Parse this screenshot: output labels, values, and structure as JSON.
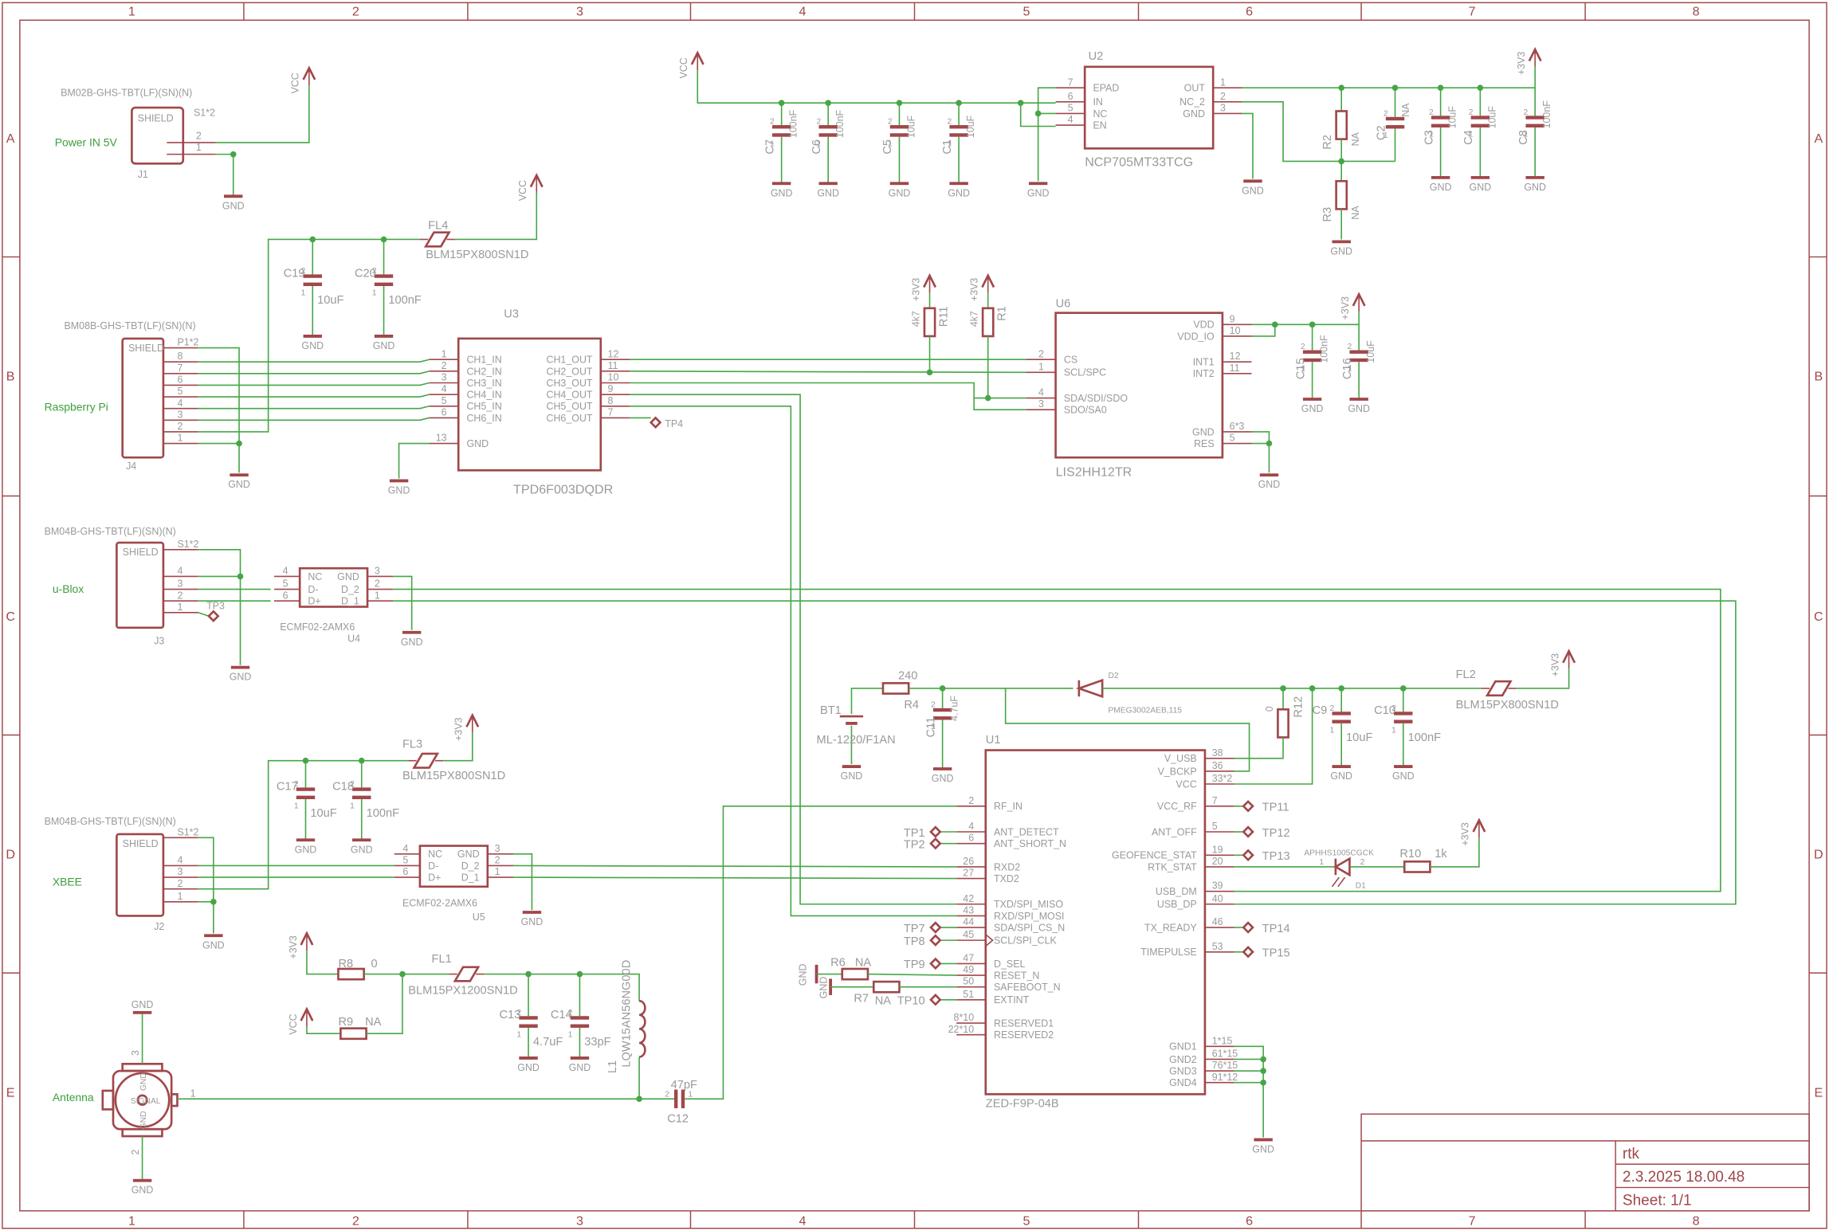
{
  "frame": {
    "columns": [
      "1",
      "2",
      "3",
      "4",
      "5",
      "6",
      "7",
      "8"
    ],
    "rows": [
      "A",
      "B",
      "C",
      "D",
      "E"
    ]
  },
  "title_block": {
    "name": "rtk",
    "date": "2.3.2025 18.00.48",
    "sheet": "Sheet: 1/1"
  },
  "nets": {
    "gnd": "GND",
    "vcc": "VCC",
    "v33": "+3V3",
    "power_in": "Power IN 5V",
    "raspberry_pi": "Raspberry Pi",
    "ublox": "u-Blox",
    "xbee": "XBEE",
    "antenna": "Antenna"
  },
  "cap_pins": [
    "1",
    "2"
  ],
  "colors": {
    "part": "#a0474a",
    "wire": "#46a646",
    "text": "#9a9a9a",
    "net_label": "#3c9e3c"
  },
  "parts": {
    "J1": {
      "ref": "J1",
      "value": "BM02B-GHS-TBT(LF)(SN)(N)",
      "shield": "SHIELD",
      "shield_pin": "S1*2",
      "pins": [
        "2",
        "1"
      ]
    },
    "J4": {
      "ref": "J4",
      "value": "BM08B-GHS-TBT(LF)(SN)(N)",
      "shield": "SHIELD",
      "shield_pin": "P1*2",
      "pins": [
        "8",
        "7",
        "6",
        "5",
        "4",
        "3",
        "2",
        "1"
      ]
    },
    "J3": {
      "ref": "J3",
      "value": "BM04B-GHS-TBT(LF)(SN)(N)",
      "shield": "SHIELD",
      "shield_pin": "S1*2",
      "pins": [
        "4",
        "3",
        "2",
        "1"
      ]
    },
    "J2": {
      "ref": "J2",
      "value": "BM04B-GHS-TBT(LF)(SN)(N)",
      "shield": "SHIELD",
      "shield_pin": "S1*2",
      "pins": [
        "4",
        "3",
        "2",
        "1"
      ]
    },
    "U2": {
      "ref": "U2",
      "value": "NCP705MT33TCG",
      "left": [
        {
          "name": "EPAD",
          "pin": "7"
        },
        {
          "name": "IN",
          "pin": "6"
        },
        {
          "name": "NC",
          "pin": "5"
        },
        {
          "name": "EN",
          "pin": "4"
        }
      ],
      "right": [
        {
          "name": "OUT",
          "pin": "1"
        },
        {
          "name": "NC_2",
          "pin": "2"
        },
        {
          "name": "GND",
          "pin": "3"
        }
      ]
    },
    "U3": {
      "ref": "U3",
      "value": "TPD6F003DQDR",
      "left": [
        {
          "name": "CH1_IN",
          "pin": "1"
        },
        {
          "name": "CH2_IN",
          "pin": "2"
        },
        {
          "name": "CH3_IN",
          "pin": "3"
        },
        {
          "name": "CH4_IN",
          "pin": "4"
        },
        {
          "name": "CH5_IN",
          "pin": "5"
        },
        {
          "name": "CH6_IN",
          "pin": "6"
        },
        {
          "name": "GND",
          "pin": "13"
        }
      ],
      "right": [
        {
          "name": "CH1_OUT",
          "pin": "12"
        },
        {
          "name": "CH2_OUT",
          "pin": "11"
        },
        {
          "name": "CH3_OUT",
          "pin": "10"
        },
        {
          "name": "CH4_OUT",
          "pin": "9"
        },
        {
          "name": "CH5_OUT",
          "pin": "8"
        },
        {
          "name": "CH6_OUT",
          "pin": "7"
        }
      ]
    },
    "U6": {
      "ref": "U6",
      "value": "LIS2HH12TR",
      "left": [
        {
          "name": "CS",
          "pin": "2"
        },
        {
          "name": "SCL/SPC",
          "pin": "1"
        },
        {
          "name": "SDA/SDI/SDO",
          "pin": "4"
        },
        {
          "name": "SDO/SA0",
          "pin": "3"
        }
      ],
      "right": [
        {
          "name": "VDD",
          "pin": "9"
        },
        {
          "name": "VDD_IO",
          "pin": "10"
        },
        {
          "name": "INT1",
          "pin": "12"
        },
        {
          "name": "INT2",
          "pin": "11"
        },
        {
          "name": "GND",
          "pin": "6*3"
        },
        {
          "name": "RES",
          "pin": "5"
        }
      ]
    },
    "U4": {
      "ref": "U4",
      "value": "ECMF02-2AMX6",
      "left": [
        {
          "name": "NC",
          "pin": "4"
        },
        {
          "name": "D-",
          "pin": "5"
        },
        {
          "name": "D+",
          "pin": "6"
        }
      ],
      "right": [
        {
          "name": "GND",
          "pin": "3"
        },
        {
          "name": "D_2",
          "pin": "2"
        },
        {
          "name": "D_1",
          "pin": "1"
        }
      ]
    },
    "U5": {
      "ref": "U5",
      "value": "ECMF02-2AMX6",
      "left": [
        {
          "name": "NC",
          "pin": "4"
        },
        {
          "name": "D-",
          "pin": "5"
        },
        {
          "name": "D+",
          "pin": "6"
        }
      ],
      "right": [
        {
          "name": "GND",
          "pin": "3"
        },
        {
          "name": "D_2",
          "pin": "2"
        },
        {
          "name": "D_1",
          "pin": "1"
        }
      ]
    },
    "U1": {
      "ref": "U1",
      "value": "ZED-F9P-04B",
      "left": [
        {
          "name": "RF_IN",
          "pin": "2"
        },
        {
          "name": "ANT_DETECT",
          "pin": "4"
        },
        {
          "name": "ANT_SHORT_N",
          "pin": "6"
        },
        {
          "name": "RXD2",
          "pin": "26"
        },
        {
          "name": "TXD2",
          "pin": "27"
        },
        {
          "name": "TXD/SPI_MISO",
          "pin": "42"
        },
        {
          "name": "RXD/SPI_MOSI",
          "pin": "43"
        },
        {
          "name": "SDA/SPI_CS_N",
          "pin": "44"
        },
        {
          "name": "SCL/SPI_CLK",
          "pin": "45"
        },
        {
          "name": "D_SEL",
          "pin": "47"
        },
        {
          "name": "RESET_N",
          "pin": "49"
        },
        {
          "name": "SAFEBOOT_N",
          "pin": "50"
        },
        {
          "name": "EXTINT",
          "pin": "51"
        },
        {
          "name": "RESERVED1",
          "pin": "8*10"
        },
        {
          "name": "RESERVED2",
          "pin": "22*10"
        }
      ],
      "right": [
        {
          "name": "V_USB",
          "pin": "38"
        },
        {
          "name": "V_BCKP",
          "pin": "36"
        },
        {
          "name": "VCC",
          "pin": "33*2"
        },
        {
          "name": "VCC_RF",
          "pin": "7"
        },
        {
          "name": "ANT_OFF",
          "pin": "5"
        },
        {
          "name": "GEOFENCE_STAT",
          "pin": "19"
        },
        {
          "name": "RTK_STAT",
          "pin": "20"
        },
        {
          "name": "USB_DM",
          "pin": "39"
        },
        {
          "name": "USB_DP",
          "pin": "40"
        },
        {
          "name": "TX_READY",
          "pin": "46"
        },
        {
          "name": "TIMEPULSE",
          "pin": "53"
        },
        {
          "name": "GND1",
          "pin": "1*15"
        },
        {
          "name": "GND2",
          "pin": "61*15"
        },
        {
          "name": "GND3",
          "pin": "76*15"
        },
        {
          "name": "GND4",
          "pin": "91*12"
        }
      ]
    },
    "caps": {
      "C7": {
        "ref": "C7",
        "value": "100nF"
      },
      "C6": {
        "ref": "C6",
        "value": "100nF"
      },
      "C5": {
        "ref": "C5",
        "value": "10uF"
      },
      "C1": {
        "ref": "C1",
        "value": "10uF"
      },
      "C2": {
        "ref": "C2",
        "value": "NA"
      },
      "C3": {
        "ref": "C3",
        "value": "10uF"
      },
      "C4": {
        "ref": "C4",
        "value": "10uF"
      },
      "C8": {
        "ref": "C8",
        "value": "100nF"
      },
      "C19": {
        "ref": "C19",
        "value": "10uF"
      },
      "C20": {
        "ref": "C20",
        "value": "100nF"
      },
      "C15": {
        "ref": "C15",
        "value": "100nF"
      },
      "C16": {
        "ref": "C16",
        "value": "10uF"
      },
      "C11": {
        "ref": "C11",
        "value": "4.7uF"
      },
      "C9": {
        "ref": "C9",
        "value": "10uF"
      },
      "C10": {
        "ref": "C10",
        "value": "100nF"
      },
      "C17": {
        "ref": "C17",
        "value": "10uF"
      },
      "C18": {
        "ref": "C18",
        "value": "100nF"
      },
      "C13": {
        "ref": "C13",
        "value": "4.7uF"
      },
      "C14": {
        "ref": "C14",
        "value": "33pF"
      },
      "C12": {
        "ref": "C12",
        "value": "47pF"
      }
    },
    "res": {
      "R1": {
        "ref": "R1",
        "value": "4k7"
      },
      "R11": {
        "ref": "R11",
        "value": "4k7"
      },
      "R2": {
        "ref": "R2",
        "value": "NA"
      },
      "R3": {
        "ref": "R3",
        "value": "NA"
      },
      "R4": {
        "ref": "R4",
        "value": "240"
      },
      "R6": {
        "ref": "R6",
        "value": "NA"
      },
      "R7": {
        "ref": "R7",
        "value": "NA"
      },
      "R8": {
        "ref": "R8",
        "value": "0"
      },
      "R9": {
        "ref": "R9",
        "value": "NA"
      },
      "R10": {
        "ref": "R10",
        "value": "1k"
      },
      "R12": {
        "ref": "R12",
        "value": "0"
      }
    },
    "filters": {
      "FL1": {
        "ref": "FL1",
        "value": "BLM15PX1200SN1D"
      },
      "FL2": {
        "ref": "FL2",
        "value": "BLM15PX800SN1D"
      },
      "FL3": {
        "ref": "FL3",
        "value": "BLM15PX800SN1D"
      },
      "FL4": {
        "ref": "FL4",
        "value": "BLM15PX800SN1D"
      }
    },
    "D1": {
      "ref": "D1",
      "value": "APHHS1005CGCK",
      "pins": [
        "1",
        "2"
      ]
    },
    "D2": {
      "ref": "D2",
      "value": "PMEG3002AEB,115"
    },
    "BT1": {
      "ref": "BT1",
      "value": "ML-1220/F1AN"
    },
    "L1": {
      "ref": "L1",
      "value": "LQW15AN56NG00D"
    },
    "ANT": {
      "pins": [
        "3",
        "2",
        "1"
      ],
      "inner": [
        "GND",
        "GND",
        "SIGNAL"
      ]
    }
  },
  "test_points": {
    "TP1": "TP1",
    "TP2": "TP2",
    "TP3": "TP3",
    "TP4": "TP4",
    "TP7": "TP7",
    "TP8": "TP8",
    "TP9": "TP9",
    "TP10": "TP10",
    "TP11": "TP11",
    "TP12": "TP12",
    "TP13": "TP13",
    "TP14": "TP14",
    "TP15": "TP15"
  }
}
